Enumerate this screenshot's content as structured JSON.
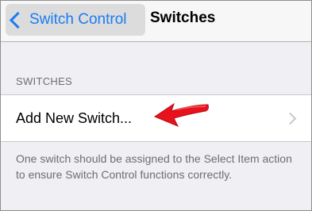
{
  "navbar": {
    "back_label": "Switch Control",
    "title": "Switches"
  },
  "section": {
    "header": "SWITCHES",
    "row_label": "Add New Switch...",
    "footer": "One switch should be assigned to the Select Item action to ensure Switch Control functions correctly."
  },
  "colors": {
    "accent": "#1a7cf5",
    "annotation_arrow": "#e8121c",
    "background": "#efeff4"
  },
  "icons": {
    "back": "chevron-left-icon",
    "disclosure": "chevron-right-icon",
    "annotation": "red-arrow-icon"
  }
}
